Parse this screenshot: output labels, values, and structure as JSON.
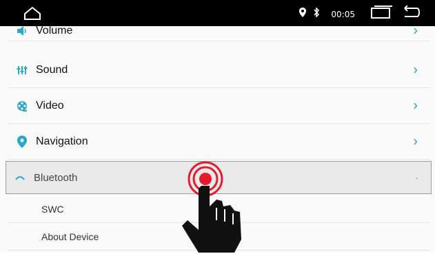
{
  "status": {
    "time": "00:05",
    "icons": [
      "home-icon",
      "location-icon",
      "bluetooth-icon",
      "recent-apps-icon",
      "back-icon"
    ]
  },
  "settings": {
    "items": [
      {
        "label": "Volume",
        "icon": "volume-icon"
      },
      {
        "label": "Sound",
        "icon": "equalizer-icon"
      },
      {
        "label": "Video",
        "icon": "film-reel-icon"
      },
      {
        "label": "Navigation",
        "icon": "location-pin-icon"
      },
      {
        "label": "Bluetooth",
        "icon": "bluetooth-icon"
      }
    ],
    "subitems": [
      {
        "label": "SWC"
      },
      {
        "label": "About Device"
      }
    ]
  },
  "colors": {
    "accent": "#2aa9c6",
    "tap_indicator": "#e8192c",
    "statusbar": "#000000"
  }
}
